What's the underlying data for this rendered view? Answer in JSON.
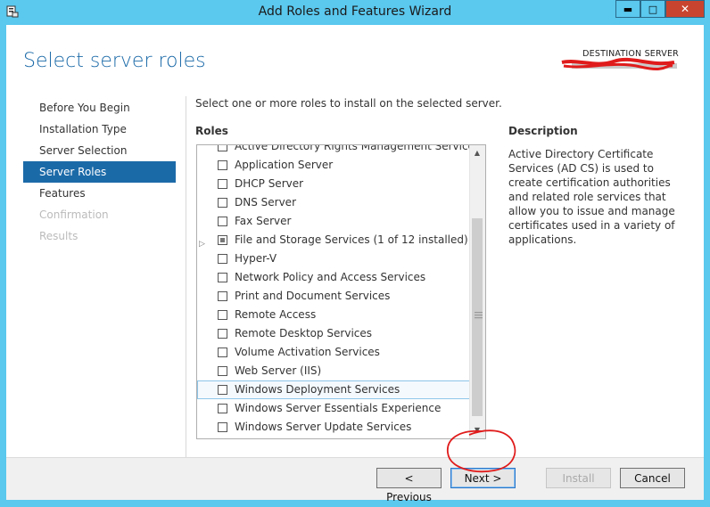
{
  "window": {
    "title": "Add Roles and Features Wizard",
    "minimize_glyph": "▬",
    "maximize_glyph": "□",
    "close_glyph": "✕"
  },
  "header": {
    "page_title": "Select server roles",
    "destination_label": "DESTINATION SERVER"
  },
  "nav": {
    "items": [
      {
        "label": "Before You Begin",
        "state": "normal"
      },
      {
        "label": "Installation Type",
        "state": "normal"
      },
      {
        "label": "Server Selection",
        "state": "normal"
      },
      {
        "label": "Server Roles",
        "state": "active"
      },
      {
        "label": "Features",
        "state": "normal"
      },
      {
        "label": "Confirmation",
        "state": "disabled"
      },
      {
        "label": "Results",
        "state": "disabled"
      }
    ]
  },
  "main": {
    "instruction": "Select one or more roles to install on the selected server.",
    "roles_header": "Roles",
    "roles": [
      {
        "label": "Active Directory Rights Management Services",
        "checked": false
      },
      {
        "label": "Application Server",
        "checked": false
      },
      {
        "label": "DHCP Server",
        "checked": false
      },
      {
        "label": "DNS Server",
        "checked": false
      },
      {
        "label": "Fax Server",
        "checked": false
      },
      {
        "label": "File and Storage Services (1 of 12 installed)",
        "checked": "partial",
        "expandable": true
      },
      {
        "label": "Hyper-V",
        "checked": false
      },
      {
        "label": "Network Policy and Access Services",
        "checked": false
      },
      {
        "label": "Print and Document Services",
        "checked": false
      },
      {
        "label": "Remote Access",
        "checked": false
      },
      {
        "label": "Remote Desktop Services",
        "checked": false
      },
      {
        "label": "Volume Activation Services",
        "checked": false
      },
      {
        "label": "Web Server (IIS)",
        "checked": false
      },
      {
        "label": "Windows Deployment Services",
        "checked": false,
        "selected": true
      },
      {
        "label": "Windows Server Essentials Experience",
        "checked": false
      },
      {
        "label": "Windows Server Update Services",
        "checked": false
      }
    ]
  },
  "description": {
    "header": "Description",
    "text": "Active Directory Certificate Services (AD CS) is used to create certification authorities and related role services that allow you to issue and manage certificates used in a variety of applications."
  },
  "footer": {
    "previous_label": "< Previous",
    "next_label": "Next >",
    "install_label": "Install",
    "cancel_label": "Cancel"
  },
  "colors": {
    "chrome": "#5bc8ee",
    "accent": "#1b6aa8",
    "close": "#c9442f",
    "annotation": "#e01b1b"
  }
}
